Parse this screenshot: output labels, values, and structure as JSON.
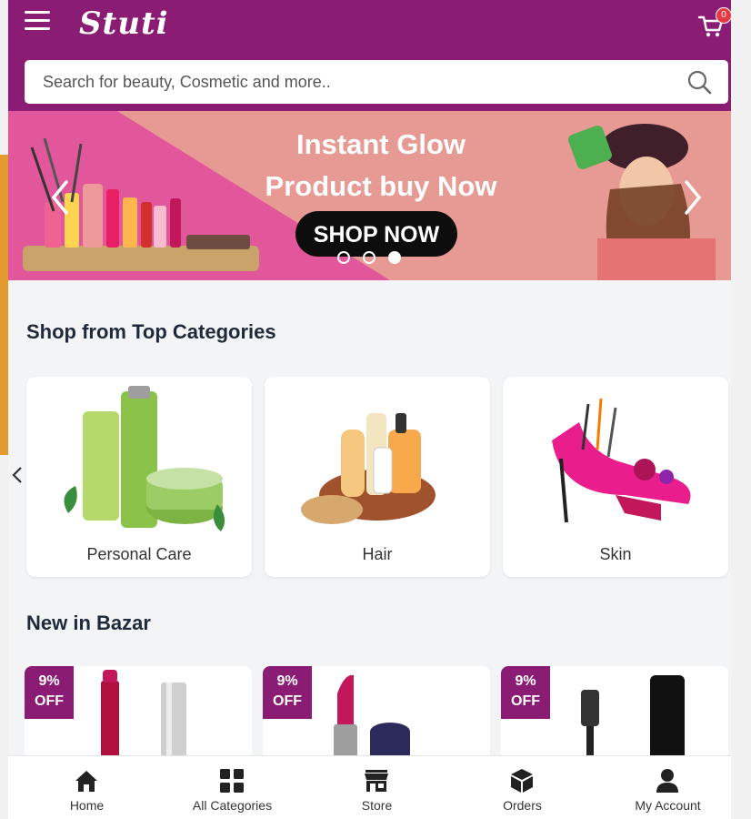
{
  "header": {
    "logo": "Stuti",
    "cart_count": "0"
  },
  "search": {
    "placeholder": "Search for beauty, Cosmetic and more.."
  },
  "banner": {
    "line1": "Instant Glow",
    "line2": "Product buy Now",
    "cta": "SHOP NOW",
    "dots": 3,
    "active_dot": 3
  },
  "categories_section": {
    "title": "Shop from Top Categories",
    "items": [
      {
        "label": "Personal Care"
      },
      {
        "label": "Hair"
      },
      {
        "label": "Skin"
      }
    ]
  },
  "new_section": {
    "title": "New in Bazar",
    "products": [
      {
        "badge_line1": "9%",
        "badge_line2": "OFF"
      },
      {
        "badge_line1": "9%",
        "badge_line2": "OFF"
      },
      {
        "badge_line1": "9%",
        "badge_line2": "OFF"
      }
    ]
  },
  "bottom_nav": [
    {
      "label": "Home",
      "icon": "home-icon"
    },
    {
      "label": "All Categories",
      "icon": "grid-icon"
    },
    {
      "label": "Store",
      "icon": "store-icon"
    },
    {
      "label": "Orders",
      "icon": "box-icon"
    },
    {
      "label": "My Account",
      "icon": "user-icon"
    }
  ],
  "colors": {
    "brand": "#8a1c74",
    "banner_pink": "#e2579b",
    "banner_peach": "#e79a93",
    "badge": "#e63946"
  }
}
